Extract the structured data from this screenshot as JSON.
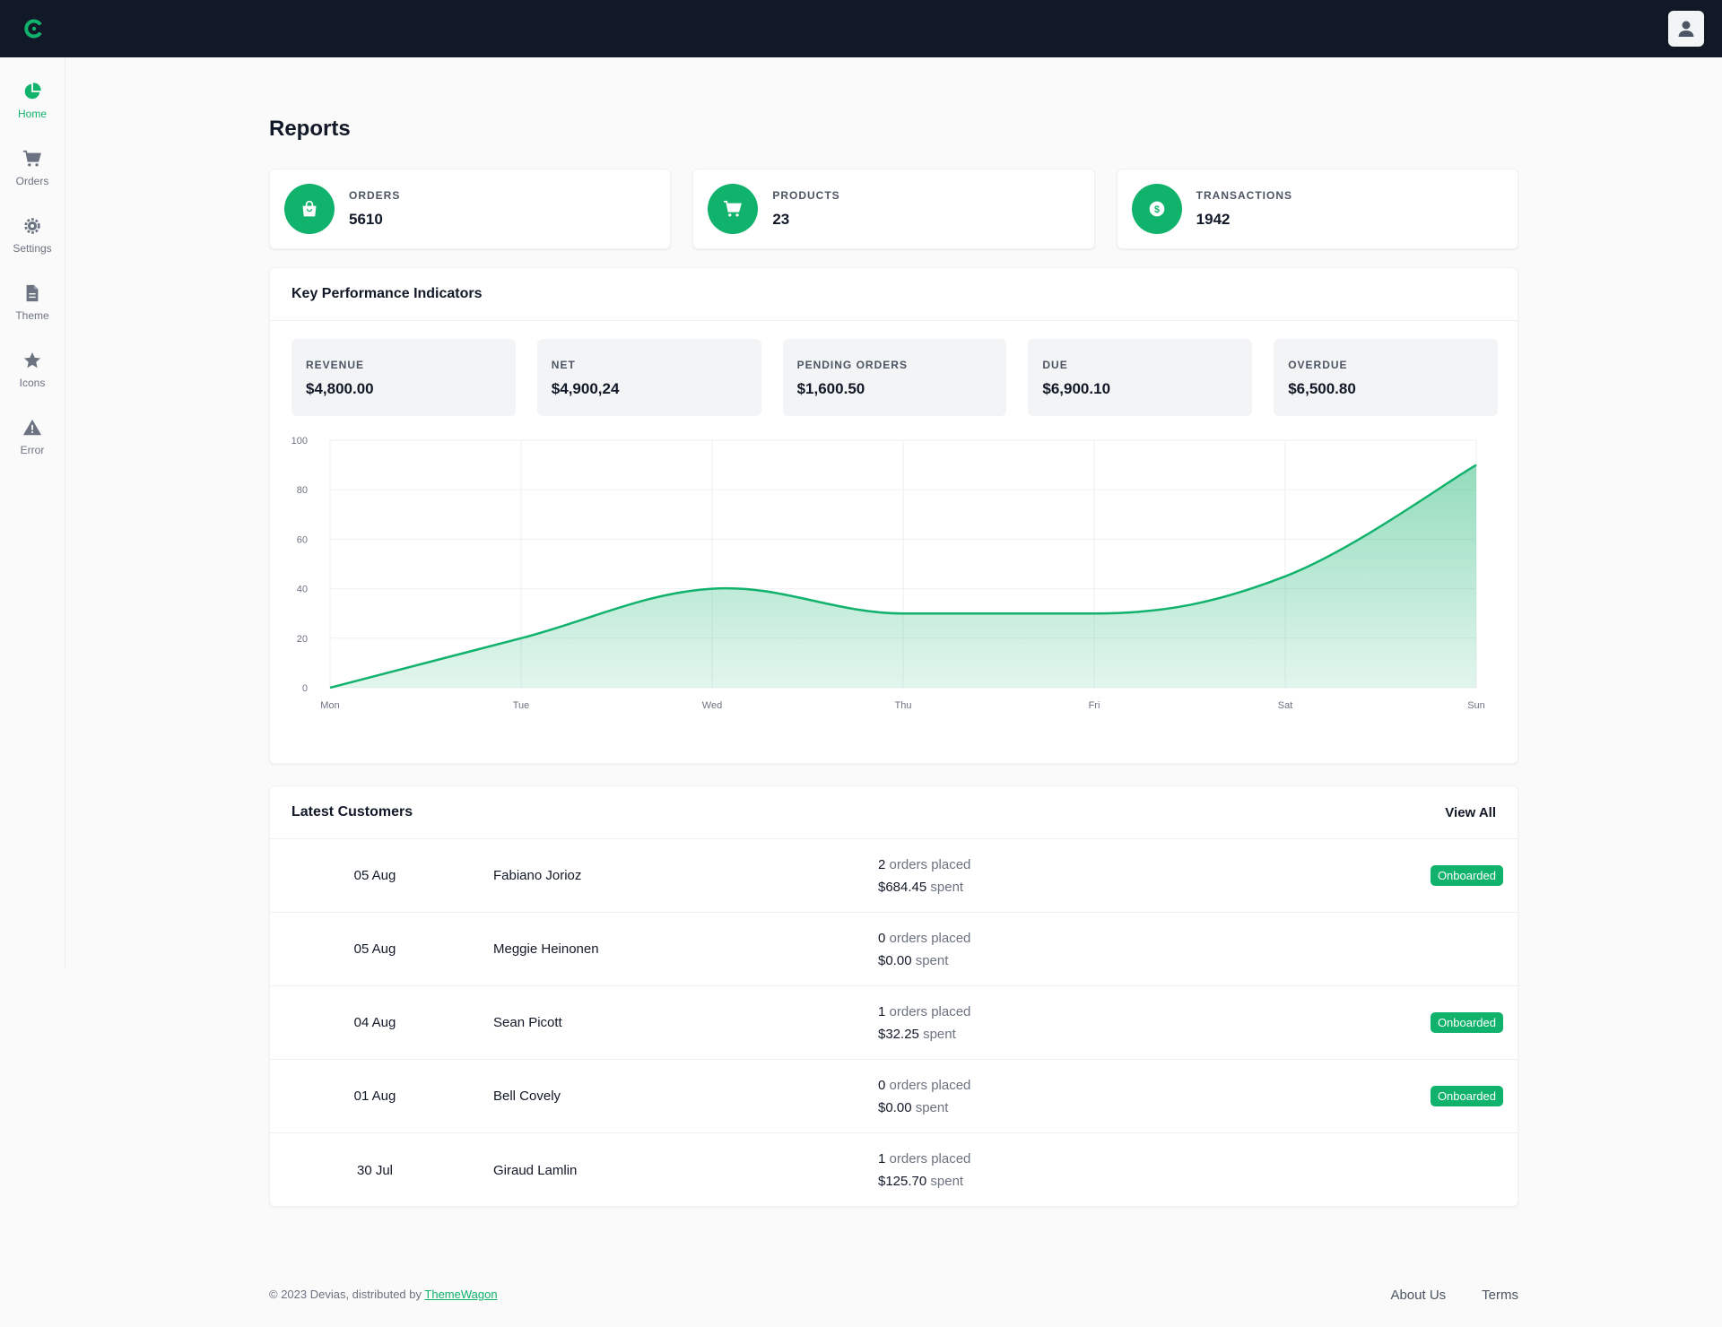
{
  "header": {
    "logo_icon": "brand-c-icon",
    "user_icon": "user-icon"
  },
  "sidebar": {
    "items": [
      {
        "label": "Home",
        "icon": "pie-chart-icon",
        "active": true
      },
      {
        "label": "Orders",
        "icon": "cart-icon",
        "active": false
      },
      {
        "label": "Settings",
        "icon": "gear-icon",
        "active": false
      },
      {
        "label": "Theme",
        "icon": "document-icon",
        "active": false
      },
      {
        "label": "Icons",
        "icon": "star-icon",
        "active": false
      },
      {
        "label": "Error",
        "icon": "warning-icon",
        "active": false
      }
    ]
  },
  "page": {
    "title": "Reports"
  },
  "stats": [
    {
      "label": "ORDERS",
      "value": "5610",
      "icon": "shopping-bag-icon"
    },
    {
      "label": "PRODUCTS",
      "value": "23",
      "icon": "cart-icon"
    },
    {
      "label": "TRANSACTIONS",
      "value": "1942",
      "icon": "dollar-icon"
    }
  ],
  "kpi": {
    "title": "Key Performance Indicators",
    "cards": [
      {
        "label": "REVENUE",
        "value": "$4,800.00"
      },
      {
        "label": "NET",
        "value": "$4,900,24"
      },
      {
        "label": "PENDING ORDERS",
        "value": "$1,600.50"
      },
      {
        "label": "DUE",
        "value": "$6,900.10"
      },
      {
        "label": "OVERDUE",
        "value": "$6,500.80"
      }
    ]
  },
  "chart_data": {
    "type": "area",
    "categories": [
      "Mon",
      "Tue",
      "Wed",
      "Thu",
      "Fri",
      "Sat",
      "Sun"
    ],
    "series": [
      {
        "values": [
          0,
          20,
          40,
          30,
          30,
          45,
          90
        ]
      }
    ],
    "yticks": [
      "0",
      "20",
      "40",
      "60",
      "80",
      "100"
    ],
    "ylim": [
      0,
      100
    ],
    "grid": true,
    "color": "#10b26c"
  },
  "customers": {
    "title": "Latest Customers",
    "view_all": "View All",
    "orders_suffix": "orders placed",
    "spent_suffix": "spent",
    "badge_label": "Onboarded",
    "rows": [
      {
        "date": "05 Aug",
        "name": "Fabiano Jorioz",
        "orders": "2",
        "spent": "$684.45",
        "onboarded": true
      },
      {
        "date": "05 Aug",
        "name": "Meggie Heinonen",
        "orders": "0",
        "spent": "$0.00",
        "onboarded": false
      },
      {
        "date": "04 Aug",
        "name": "Sean Picott",
        "orders": "1",
        "spent": "$32.25",
        "onboarded": true
      },
      {
        "date": "01 Aug",
        "name": "Bell Covely",
        "orders": "0",
        "spent": "$0.00",
        "onboarded": true
      },
      {
        "date": "30 Jul",
        "name": "Giraud Lamlin",
        "orders": "1",
        "spent": "$125.70",
        "onboarded": false
      }
    ]
  },
  "footer": {
    "copyright": "© 2023 Devias, distributed by",
    "link_label": "ThemeWagon",
    "links": [
      "About Us",
      "Terms"
    ]
  },
  "colors": {
    "accent": "#10b26c",
    "topbar": "#111827"
  }
}
